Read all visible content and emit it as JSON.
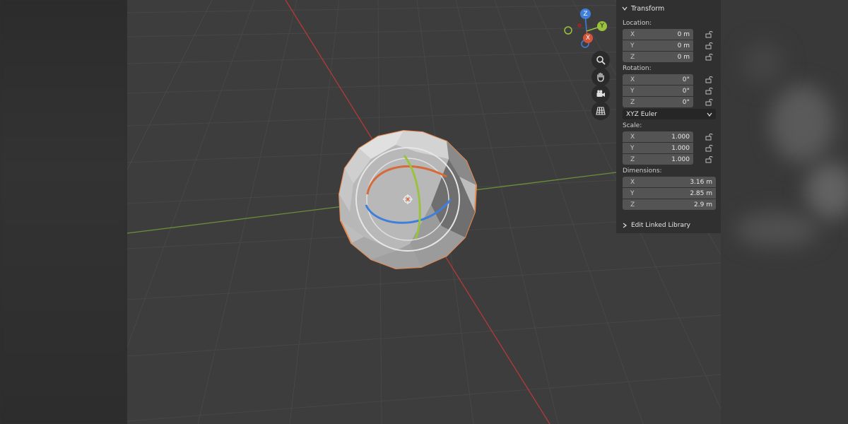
{
  "viewport": {
    "navigation_gizmo": {
      "axes": [
        "Z",
        "Y",
        "X"
      ]
    },
    "tools": [
      {
        "name": "zoom",
        "icon": "magnifier-icon"
      },
      {
        "name": "pan",
        "icon": "hand-icon"
      },
      {
        "name": "camera",
        "icon": "camera-icon"
      },
      {
        "name": "ortho",
        "icon": "grid-icon"
      }
    ],
    "colors": {
      "x_axis": "#c04040",
      "y_axis": "#6a8f3a",
      "selection_outline": "#e8884a"
    }
  },
  "panel": {
    "title": "Transform",
    "location": {
      "label": "Location:",
      "x_label": "X",
      "x": "0 m",
      "y_label": "Y",
      "y": "0 m",
      "z_label": "Z",
      "z": "0 m"
    },
    "rotation": {
      "label": "Rotation:",
      "x_label": "X",
      "x": "0°",
      "y_label": "Y",
      "y": "0°",
      "z_label": "Z",
      "z": "0°",
      "mode": "XYZ Euler"
    },
    "scale": {
      "label": "Scale:",
      "x_label": "X",
      "x": "1.000",
      "y_label": "Y",
      "y": "1.000",
      "z_label": "Z",
      "z": "1.000"
    },
    "dimensions": {
      "label": "Dimensions:",
      "x_label": "X",
      "x": "3.16 m",
      "y_label": "Y",
      "y": "2.85 m",
      "z_label": "Z",
      "z": "2.9 m"
    },
    "edit_linked_library": "Edit Linked Library"
  }
}
